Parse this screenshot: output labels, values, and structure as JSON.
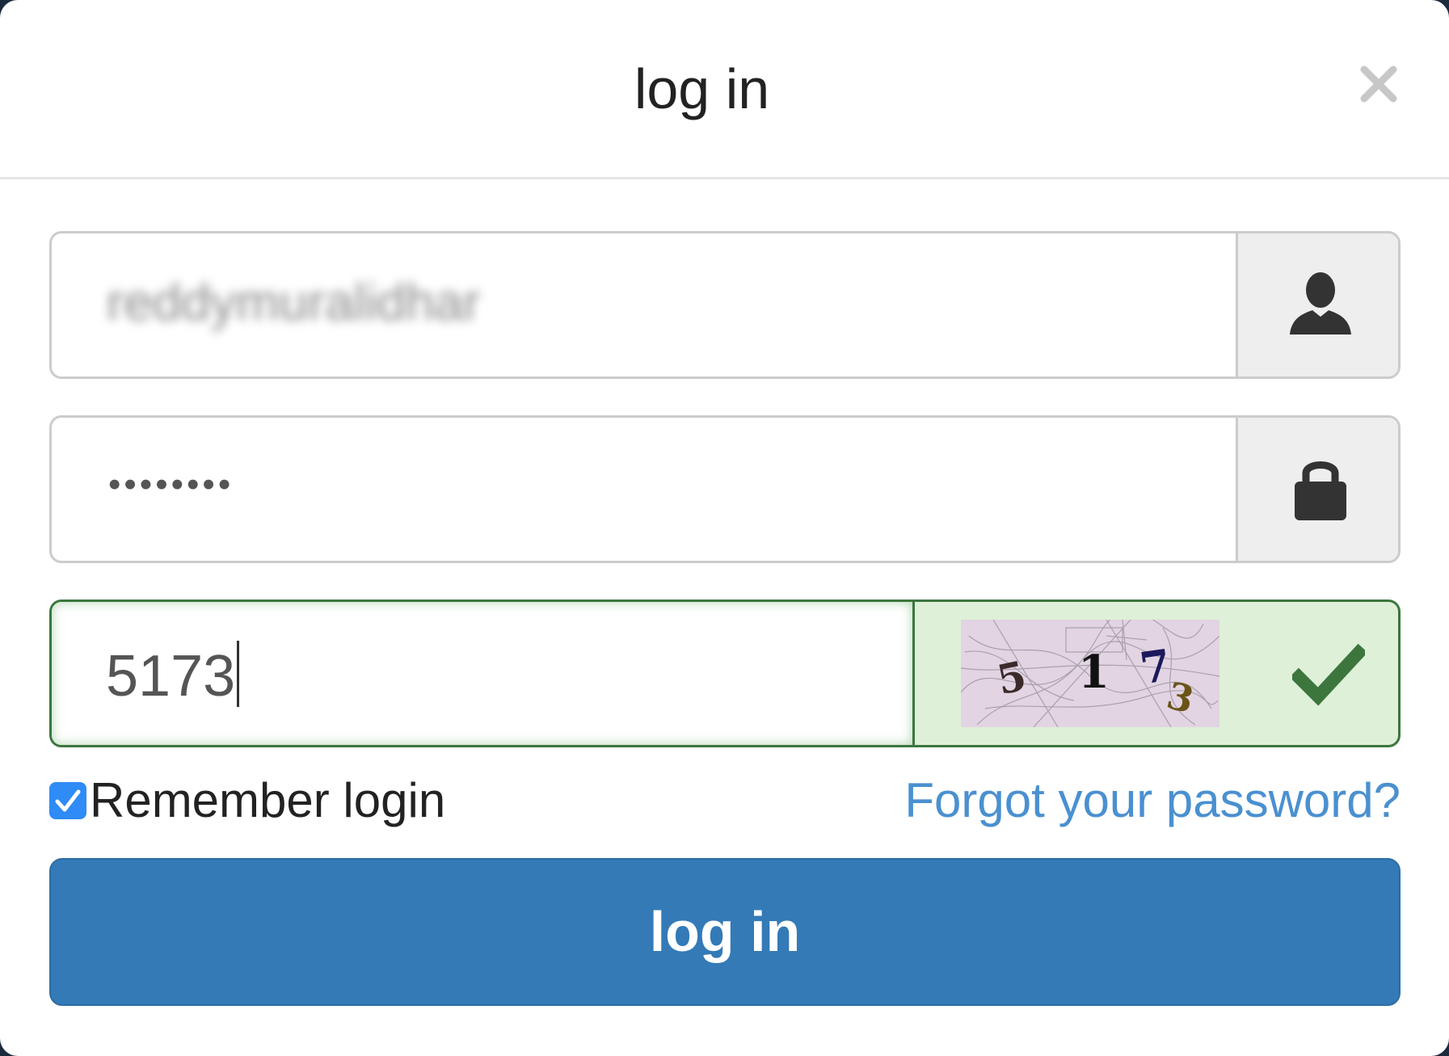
{
  "modal": {
    "title": "log in",
    "close_label": "×"
  },
  "username": {
    "value": "reddymuralidhar",
    "icon": "user-icon"
  },
  "password": {
    "masked_value": "••••••••",
    "icon": "lock-icon"
  },
  "captcha": {
    "input_value": "5173",
    "image_chars": [
      "5",
      "1",
      "7",
      "3"
    ],
    "status_icon": "checkmark-icon",
    "status_color": "#3c763d"
  },
  "remember": {
    "label": "Remember login",
    "checked": true
  },
  "forgot_link": "Forgot your password?",
  "submit_label": "log in",
  "colors": {
    "primary": "#337ab7",
    "link": "#4a90d0",
    "success_bg": "#dff0d8",
    "success_border": "#3c763d",
    "checkbox": "#2f8bf5"
  }
}
